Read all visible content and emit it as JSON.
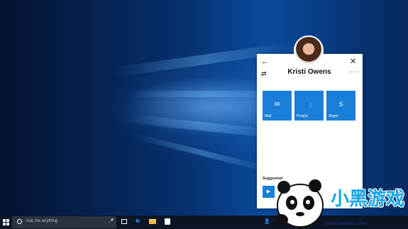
{
  "flyout": {
    "contact_name": "Kristi Owens",
    "back_glyph": "←",
    "close_glyph": "✕",
    "swap_glyph": "⇄",
    "more_glyph": "···",
    "tiles": [
      {
        "label": "Mail",
        "icon": "mail-icon",
        "glyph": "✉"
      },
      {
        "label": "People",
        "icon": "people-icon",
        "glyph": "👥"
      },
      {
        "label": "Skype",
        "icon": "skype-icon",
        "glyph": "S"
      }
    ],
    "suggested_label": "Suggested",
    "suggested_glyph": "▶"
  },
  "taskbar": {
    "search_placeholder": "Ask me anything",
    "edge_glyph": "e",
    "mic_glyph": "🎤"
  },
  "watermark": {
    "brand_text": "小黑游戏",
    "url": "www.xiaohei.com"
  },
  "colors": {
    "accent": "#1a7fd8",
    "taskbar": "#0b1524"
  }
}
